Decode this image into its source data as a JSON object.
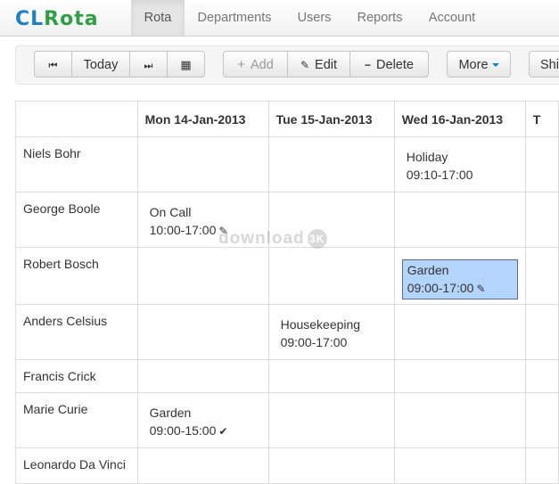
{
  "brand": {
    "part1": "CL",
    "part2": "Rota"
  },
  "nav": [
    {
      "label": "Rota",
      "active": true
    },
    {
      "label": "Departments"
    },
    {
      "label": "Users"
    },
    {
      "label": "Reports"
    },
    {
      "label": "Account"
    }
  ],
  "toolbar": {
    "first_icon": "⏮",
    "today": "Today",
    "last_icon": "⏭",
    "calendar_icon": "▦",
    "add_icon": "+",
    "add": "Add",
    "edit_icon": "✎",
    "edit": "Edit",
    "delete_icon": "−",
    "delete": "Delete",
    "more": "More",
    "shift": "Shif"
  },
  "grid": {
    "days": [
      "Mon 14-Jan-2013",
      "Tue 15-Jan-2013",
      "Wed 16-Jan-2013",
      "T"
    ],
    "rows": [
      {
        "name": "Niels Bohr",
        "shifts": [
          null,
          null,
          {
            "title": "Holiday",
            "time": "09:10-17:00"
          },
          null
        ]
      },
      {
        "name": "George Boole",
        "shifts": [
          {
            "title": "On Call",
            "time": "10:00-17:00",
            "mark": "✎"
          },
          null,
          null,
          null
        ]
      },
      {
        "name": "Robert Bosch",
        "shifts": [
          null,
          null,
          {
            "title": "Garden",
            "time": "09:00-17:00",
            "mark": "✎",
            "selected": true
          },
          null
        ]
      },
      {
        "name": "Anders Celsius",
        "shifts": [
          null,
          {
            "title": "Housekeeping",
            "time": "09:00-17:00"
          },
          null,
          null
        ]
      },
      {
        "name": "Francis Crick",
        "shifts": [
          null,
          null,
          null,
          null
        ]
      },
      {
        "name": "Marie Curie",
        "shifts": [
          {
            "title": "Garden",
            "time": "09:00-15:00",
            "mark": "✔"
          },
          null,
          null,
          null
        ]
      },
      {
        "name": "Leonardo Da Vinci",
        "shifts": [
          null,
          null,
          null,
          null
        ]
      }
    ]
  },
  "watermark": {
    "text": "download",
    "badge": "3K"
  }
}
